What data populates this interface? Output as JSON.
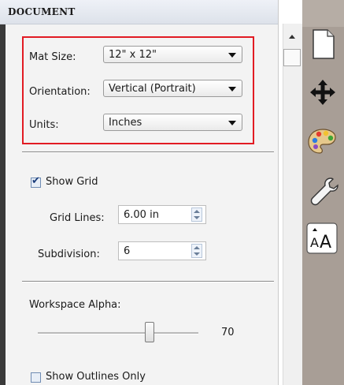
{
  "panel": {
    "title": "DOCUMENT"
  },
  "mat": {
    "mat_size_label": "Mat Size:",
    "mat_size_value": "12\" x 12\"",
    "orientation_label": "Orientation:",
    "orientation_value": "Vertical (Portrait)",
    "units_label": "Units:",
    "units_value": "Inches"
  },
  "grid": {
    "show_grid_label": "Show Grid",
    "show_grid_checked": true,
    "grid_lines_label": "Grid Lines:",
    "grid_lines_value": "6.00 in",
    "subdivision_label": "Subdivision:",
    "subdivision_value": "6"
  },
  "workspace": {
    "alpha_label": "Workspace Alpha:",
    "alpha_value": "70",
    "show_outlines_label": "Show Outlines Only",
    "show_outlines_checked": false
  },
  "toolbar": {
    "icons": [
      "document-icon",
      "move-icon",
      "palette-icon",
      "wrench-icon",
      "text-size-icon"
    ]
  },
  "colors": {
    "highlight": "#e21b23",
    "toolbar_bg": "#a89e96"
  }
}
